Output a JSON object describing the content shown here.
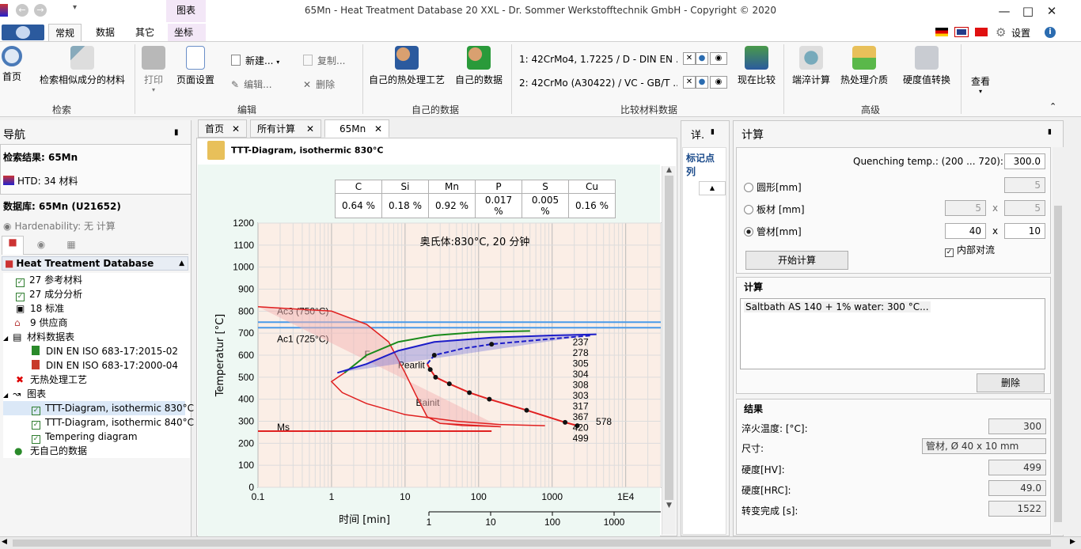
{
  "window": {
    "title": "65Mn   - Heat Treatment Database 20 XXL - Dr. Sommer Werkstofftechnik GmbH - Copyright © 2020",
    "context_tab": "图表"
  },
  "ribbon": {
    "tabs": [
      "常规",
      "数据",
      "其它",
      "坐标"
    ],
    "settings": "设置",
    "home": "首页",
    "search_similar": "检索相似成分的材料",
    "print": "打印",
    "page_setup": "页面设置",
    "new": "新建...",
    "copy": "复制...",
    "edit": "编辑...",
    "delete": "删除",
    "own_process": "自己的热处理工艺",
    "own_data": "自己的数据",
    "compare1": "1: 42CrMo4, 1.7225 / D - DIN EN ...",
    "compare2": "2: 42CrMo (A30422) / VC - GB/T ...",
    "compare_now": "现在比较",
    "quench_calc": "端淬计算",
    "quench_media": "热处理介质",
    "hardness_convert": "硬度值转换",
    "view": "查看",
    "groups": [
      "检索",
      "编辑",
      "自己的数据",
      "比较材料数据",
      "高级"
    ]
  },
  "nav": {
    "title": "导航",
    "search_result": "检索结果: 65Mn",
    "htd": "HTD: 34 材料",
    "database": "数据库: 65Mn (U21652)",
    "hardenability": "Hardenability: 无 计算",
    "tree_root": "Heat Treatment Database",
    "items": [
      "27 参考材料",
      "27 成分分析",
      "18 标准",
      "9 供应商",
      "材料数据表",
      "DIN EN ISO 683-17:2015-02",
      "DIN EN ISO 683-17:2000-04",
      "无热处理工艺",
      "图表",
      "TTT-Diagram, isothermic 830°C",
      "TTT-Diagram, isothermic 840°C",
      "Tempering diagram",
      "无自己的数据"
    ]
  },
  "doc": {
    "tabs": [
      "首页",
      "所有计算",
      "65Mn"
    ],
    "header": "TTT-Diagram, isothermic 830°C",
    "composition": {
      "headers": [
        "C",
        "Si",
        "Mn",
        "P",
        "S",
        "Cu"
      ],
      "values": [
        "0.64 %",
        "0.18 %",
        "0.92 %",
        "0.017 %",
        "0.005 %",
        "0.16 %"
      ]
    },
    "side_title": "详.",
    "side_col": "标记点列"
  },
  "chart_data": {
    "type": "line",
    "title": "奥氏体:830°C, 20 分钟",
    "xlabel": "时间 [min]",
    "ylabel": "Temperatur [°C]",
    "x_scale": "log",
    "xlim": [
      0.1,
      30000
    ],
    "ylim": [
      0,
      1200
    ],
    "xticks": [
      "0.1",
      "1",
      "10",
      "100",
      "1000",
      "1E4",
      "1E5"
    ],
    "yticks": [
      "0",
      "100",
      "200",
      "300",
      "400",
      "500",
      "600",
      "700",
      "800",
      "900",
      "1000",
      "1100",
      "1200"
    ],
    "x2ticks": [
      "1",
      "10",
      "100",
      "1000"
    ],
    "lines": {
      "Ac3": 750,
      "Ac1": 725,
      "Ms": 255
    },
    "labels": {
      "ac3": "Ac3 (750°C)",
      "ac1": "Ac1 (725°C)",
      "ms": "Ms",
      "ferrite": "F",
      "pearlite": "Pearlit",
      "bainite": "Bainit"
    },
    "cooling_points": [
      {
        "t": 25,
        "T": 600,
        "hv": "278"
      },
      {
        "t": 150,
        "T": 650,
        "hv": "237"
      },
      {
        "t": 22,
        "T": 535,
        "hv": "305"
      },
      {
        "t": 26,
        "T": 500,
        "hv": "304"
      },
      {
        "t": 40,
        "T": 470,
        "hv": "308"
      },
      {
        "t": 75,
        "T": 430,
        "hv": "303"
      },
      {
        "t": 140,
        "T": 400,
        "hv": "317"
      },
      {
        "t": 450,
        "T": 350,
        "hv": "367"
      },
      {
        "t": 1500,
        "T": 295,
        "hv": "420"
      },
      {
        "t": 2200,
        "T": 280,
        "hv": "499"
      }
    ],
    "hv_labels": [
      "237",
      "278",
      "305",
      "304",
      "308",
      "303",
      "317",
      "367",
      "420",
      "499",
      "578"
    ]
  },
  "calc": {
    "title": "计算",
    "quench_label": "Quenching temp.: (200 ... 720):",
    "quench_value": "300.0",
    "round": "圆形[mm]",
    "round_val": "5",
    "plate": "板材 [mm]",
    "plate_a": "5",
    "plate_b": "5",
    "tube": "管材[mm]",
    "tube_a": "40",
    "tube_b": "10",
    "internal": "内部对流",
    "start": "开始计算",
    "calc_title": "计算",
    "calc_text": "Saltbath AS 140 + 1% water: 300 °C...",
    "delete": "删除",
    "result_title": "结果",
    "results": [
      {
        "label": "淬火温度: [°C]:",
        "value": "300"
      },
      {
        "label": "尺寸:",
        "value": "管材, Ø 40 x 10 mm"
      },
      {
        "label": "硬度[HV]:",
        "value": "499"
      },
      {
        "label": "硬度[HRC]:",
        "value": "49.0"
      },
      {
        "label": "转变完成 [s]:",
        "value": "1522"
      }
    ]
  },
  "colors": {
    "accent": "#2b6cb0",
    "ac_lines": "#3a8fe0",
    "curve_red": "#e02020",
    "green": "#1a8a1a",
    "blue": "#1c1cc8"
  }
}
